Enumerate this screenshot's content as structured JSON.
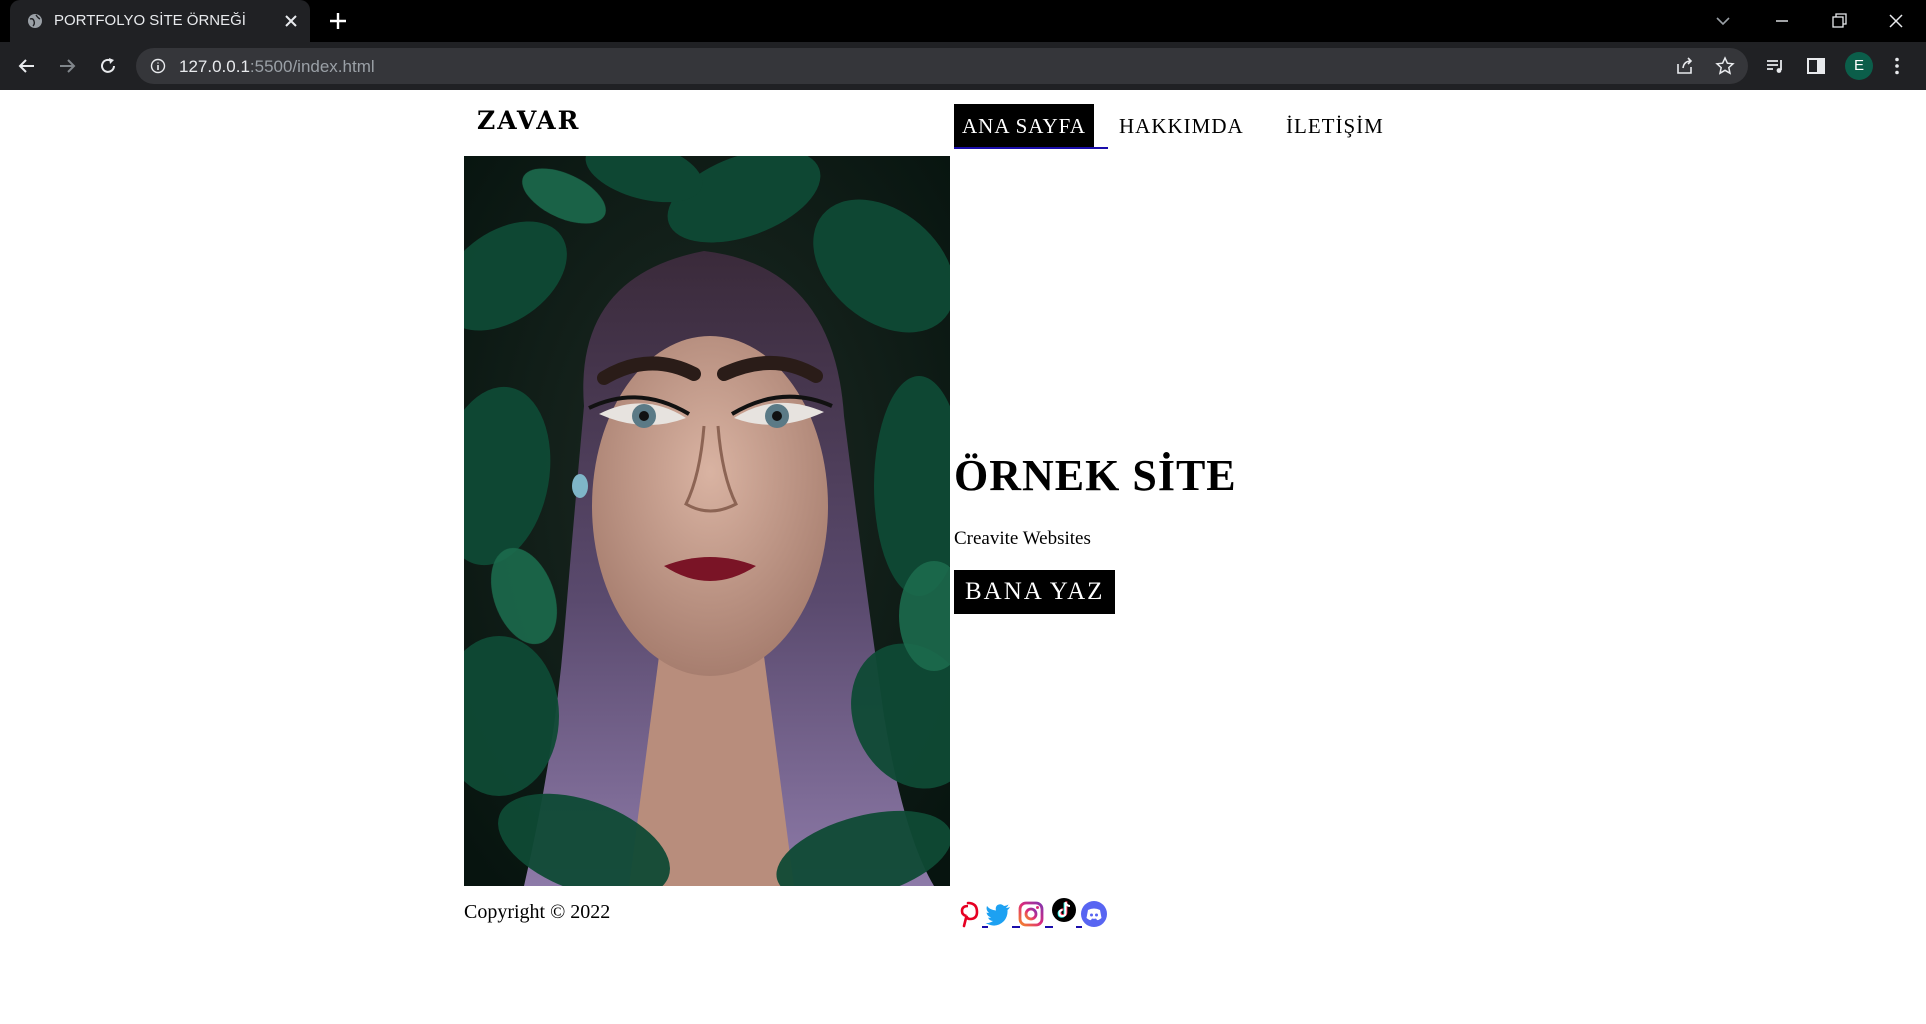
{
  "browser": {
    "tab_title": "PORTFOLYO SİTE ÖRNEĞİ",
    "url_host": "127.0.0.1",
    "url_path": ":5500/index.html",
    "profile_initial": "E"
  },
  "page": {
    "logo": "ZAVAR",
    "nav": [
      {
        "label": "ANA SAYFA",
        "active": true
      },
      {
        "label": "HAKKIMDA",
        "active": false
      },
      {
        "label": "İLETİŞİM",
        "active": false
      }
    ],
    "hero": {
      "title": "ÖRNEK SİTE",
      "subtitle": "Creavite Websites",
      "cta_label": "BANA YAZ"
    },
    "footer": {
      "copyright": "Copyright © 2022",
      "social_icons": [
        "pinterest-icon",
        "twitter-icon",
        "instagram-icon",
        "tiktok-icon",
        "discord-icon"
      ]
    }
  },
  "colors": {
    "accent": "#000000",
    "link": "#1a0dab",
    "pinterest": "#e60023",
    "twitter": "#1da1f2",
    "discord": "#5865f2"
  }
}
